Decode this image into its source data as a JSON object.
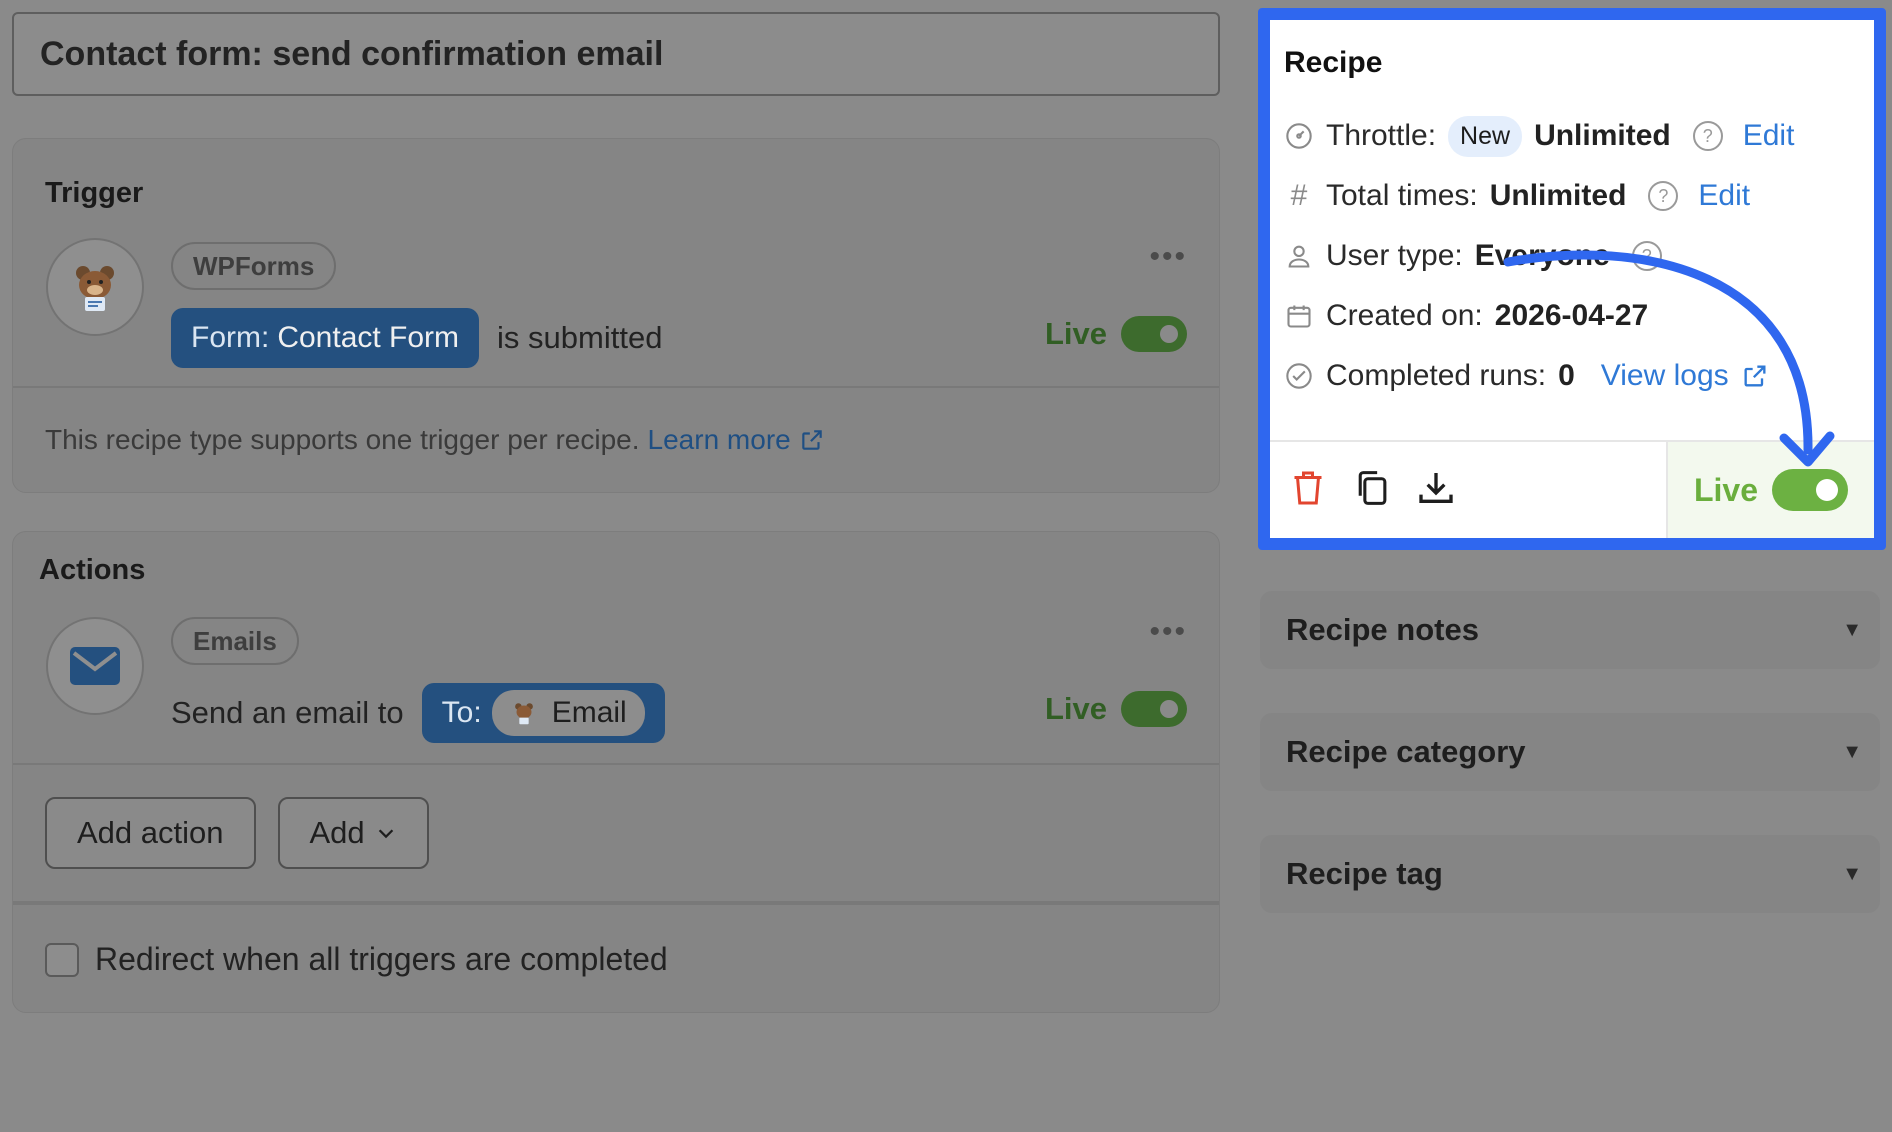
{
  "recipe_title": "Contact form: send confirmation email",
  "trigger": {
    "heading": "Trigger",
    "integration": "WPForms",
    "token_label": "Form:",
    "token_value": "Contact Form",
    "sentence_suffix": "is submitted",
    "status_label": "Live",
    "note": "This recipe type supports one trigger per recipe.",
    "learn_more": "Learn more"
  },
  "actions": {
    "heading": "Actions",
    "integration": "Emails",
    "sentence_prefix": "Send an email to",
    "token_label": "To:",
    "token_value": "Email",
    "status_label": "Live",
    "add_action_label": "Add action",
    "add_label": "Add",
    "redirect_label": "Redirect when all triggers are completed"
  },
  "recipe_panel": {
    "title": "Recipe",
    "throttle_label": "Throttle:",
    "throttle_badge": "New",
    "throttle_value": "Unlimited",
    "throttle_edit": "Edit",
    "total_label": "Total times:",
    "total_value": "Unlimited",
    "total_edit": "Edit",
    "user_type_label": "User type:",
    "user_type_value": "Everyone",
    "created_label": "Created on:",
    "created_value": "2026-04-27",
    "runs_label": "Completed runs:",
    "runs_value": "0",
    "view_logs": "View logs",
    "live_label": "Live"
  },
  "accordions": {
    "notes": "Recipe notes",
    "category": "Recipe category",
    "tag": "Recipe tag"
  },
  "colors": {
    "accent_blue": "#2f67ef",
    "live_green": "#6cb142",
    "delete_red": "#e2452f",
    "link_blue": "#2f79d6"
  }
}
